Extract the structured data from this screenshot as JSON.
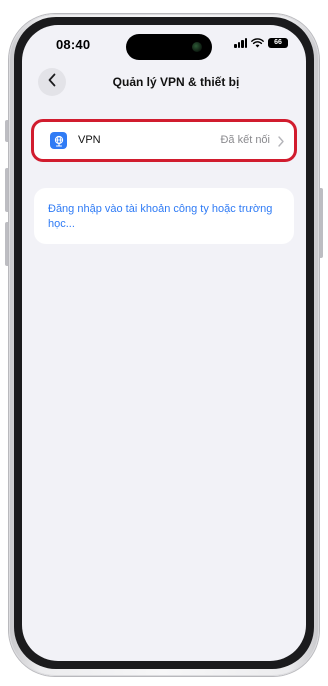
{
  "status_bar": {
    "time": "08:40",
    "battery": "66",
    "icons": [
      "signal-icon",
      "wifi-icon",
      "battery-icon"
    ]
  },
  "nav": {
    "back_icon": "chevron-left-icon",
    "title": "Quản lý VPN & thiết bị"
  },
  "vpn_row": {
    "icon": "vpn-globe-icon",
    "label": "VPN",
    "status": "Đã kết nối",
    "chevron_icon": "chevron-right-icon",
    "highlight_color": "#d11c2e"
  },
  "signin": {
    "text": "Đăng nhập vào tài khoản công ty hoặc trường học..."
  },
  "colors": {
    "background": "#f2f2f7",
    "accent": "#2f7bf5",
    "secondary_text": "#8a8a8e"
  }
}
